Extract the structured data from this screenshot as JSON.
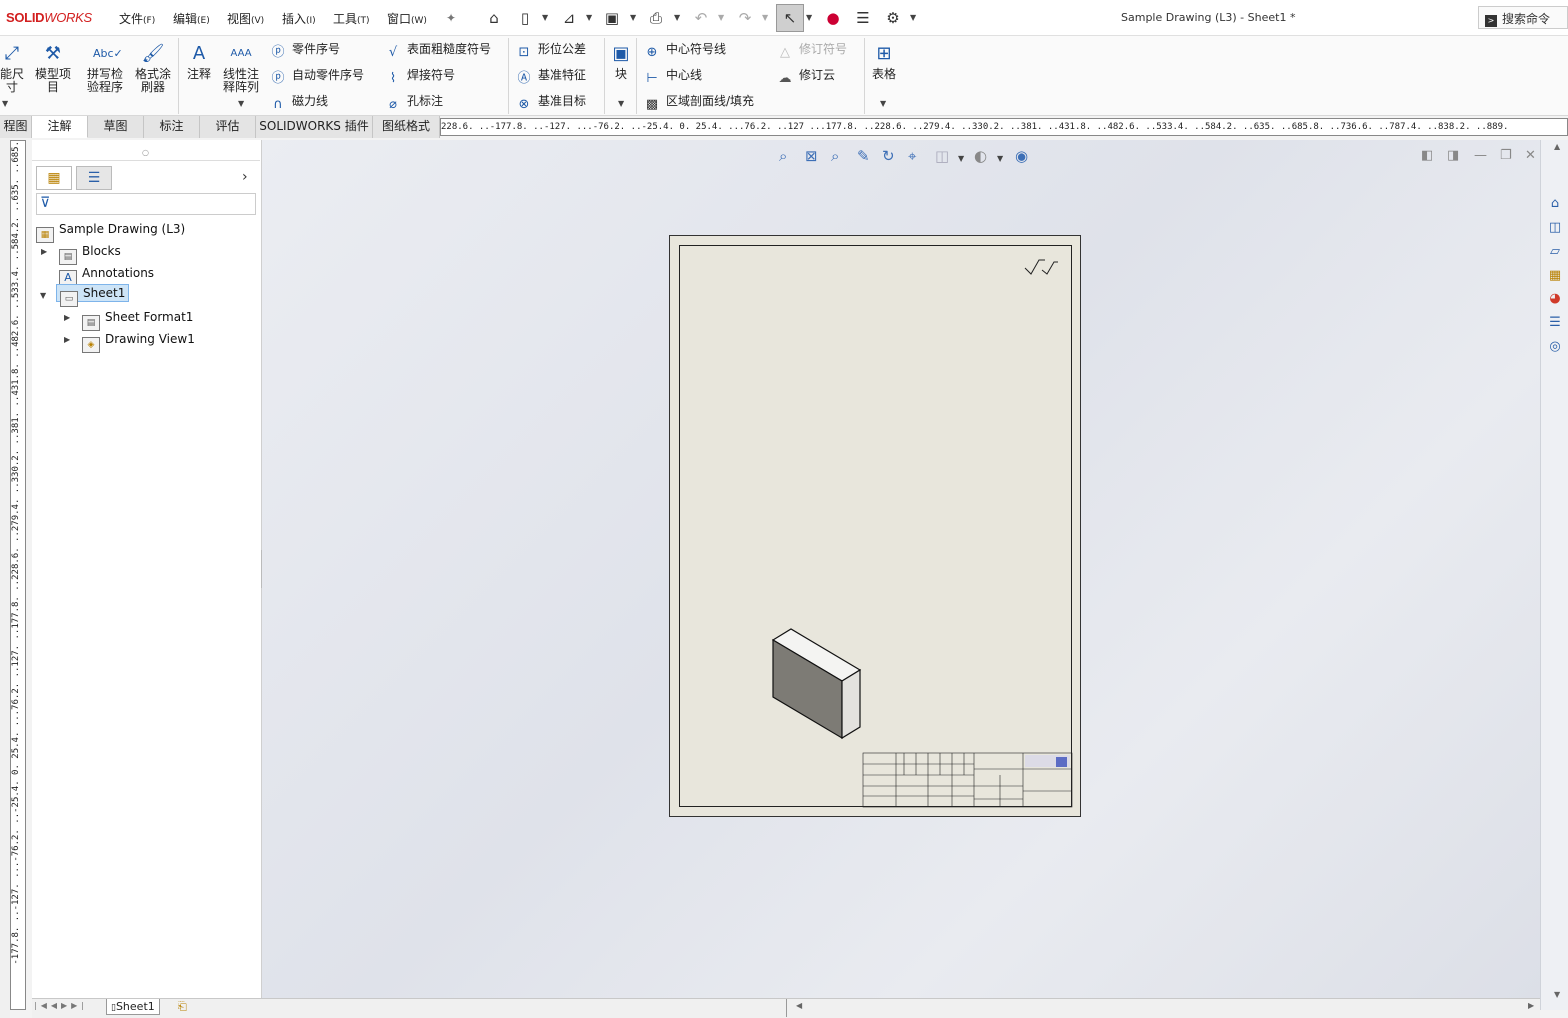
{
  "app": {
    "logo_solid": "SOLID",
    "logo_works": "WORKS",
    "title": "Sample Drawing (L3) - Sheet1 *"
  },
  "menu": [
    {
      "label": "文件",
      "key": "(F)"
    },
    {
      "label": "编辑",
      "key": "(E)"
    },
    {
      "label": "视图",
      "key": "(V)"
    },
    {
      "label": "插入",
      "key": "(I)"
    },
    {
      "label": "工具",
      "key": "(T)"
    },
    {
      "label": "窗口",
      "key": "(W)"
    }
  ],
  "search": {
    "placeholder": "搜索命令"
  },
  "ribbon": {
    "smart_dim_line1": "能尺",
    "smart_dim_line2": "寸",
    "model_items_line1": "模型项",
    "model_items_line2": "目",
    "spell_line1": "拼写检",
    "spell_line2": "验程序",
    "format_painter_line1": "格式涂",
    "format_painter_line2": "刷器",
    "note": "注释",
    "linear_note_line1": "线性注",
    "linear_note_line2": "释阵列",
    "balloon": "零件序号",
    "auto_balloon": "自动零件序号",
    "magnetic_line": "磁力线",
    "surface_finish": "表面粗糙度符号",
    "weld_symbol": "焊接符号",
    "hole_callout": "孔标注",
    "geometric_tolerance": "形位公差",
    "datum_feature": "基准特征",
    "datum_target": "基准目标",
    "block": "块",
    "center_mark": "中心符号线",
    "centerline": "中心线",
    "area_hatch": "区域剖面线/填充",
    "revision_symbol": "修订符号",
    "revision_cloud": "修订云",
    "tables": "表格"
  },
  "tabs": [
    "程图",
    "注解",
    "草图",
    "标注",
    "评估",
    "SOLIDWORKS 插件",
    "图纸格式"
  ],
  "active_tab": "注解",
  "rulers": {
    "horizontal": "228.6. ..-177.8. ..-127. ...-76.2. ..-25.4. 0. 25.4. ...76.2. ..127 ...177.8. ..228.6. ..279.4. ..330.2. ..381. ..431.8. ..482.6. ..533.4. ..584.2. ..635. ..685.8. ..736.6. ..787.4. ..838.2. ..889.",
    "vertical": "-177.8. ..-127. ...-76.2. ..-25.4. 0. 25.4. ...76.2. ..127. ..177.8. ..228.6. ..279.4. ..330.2. ..381. ..431.8. ..482.6. ..533.4. ..584.2. ..635. ..685."
  },
  "tree": {
    "root": "Sample Drawing (L3)",
    "items": [
      {
        "label": "Blocks",
        "level": 1,
        "expandable": true
      },
      {
        "label": "Annotations",
        "level": 1,
        "expandable": false
      },
      {
        "label": "Sheet1",
        "level": 1,
        "expandable": true,
        "expanded": true,
        "selected": true
      },
      {
        "label": "Sheet Format1",
        "level": 2,
        "expandable": true
      },
      {
        "label": "Drawing View1",
        "level": 2,
        "expandable": true
      }
    ]
  },
  "bottom": {
    "sheet_tab": "Sheet1"
  },
  "colors": {
    "accent": "#1e5aa8",
    "logo": "#d21f1f",
    "sheet_bg": "#e8e6dc",
    "selection": "#cde4f7"
  }
}
